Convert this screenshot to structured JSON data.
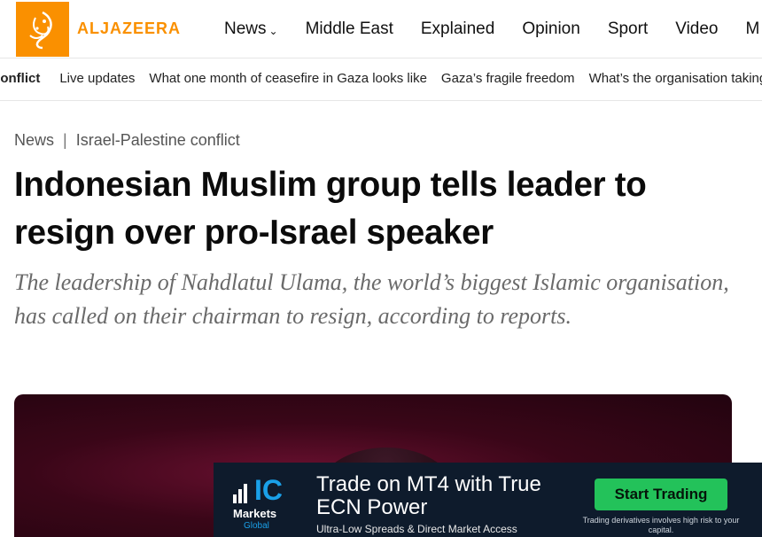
{
  "header": {
    "logo_text": "ALJAZEERA",
    "brand_color": "#fa9000",
    "nav": [
      {
        "label": "News",
        "has_dropdown": true
      },
      {
        "label": "Middle East"
      },
      {
        "label": "Explained"
      },
      {
        "label": "Opinion"
      },
      {
        "label": "Sport"
      },
      {
        "label": "Video"
      },
      {
        "label": "M"
      }
    ]
  },
  "subnav": {
    "topic": "conflict",
    "items": [
      "Live updates",
      "What one month of ceasefire in Gaza looks like",
      "Gaza’s fragile freedom",
      "What’s the organisation taking"
    ]
  },
  "article": {
    "breadcrumb": [
      "News",
      "Israel-Palestine conflict"
    ],
    "headline": "Indonesian Muslim group tells leader to resign over pro-Israel speaker",
    "dek": "The leadership of Nahdlatul Ulama, the world’s biggest Islamic organisation, has called on their chairman to resign, according to reports."
  },
  "ad": {
    "brand_ic": "IC",
    "brand_markets": "Markets",
    "brand_global": "Global",
    "headline": "Trade on MT4 with True ECN Power",
    "subline": "Ultra-Low Spreads & Direct Market Access",
    "cta": "Start Trading",
    "risk": "Trading derivatives involves high risk to your capital."
  }
}
